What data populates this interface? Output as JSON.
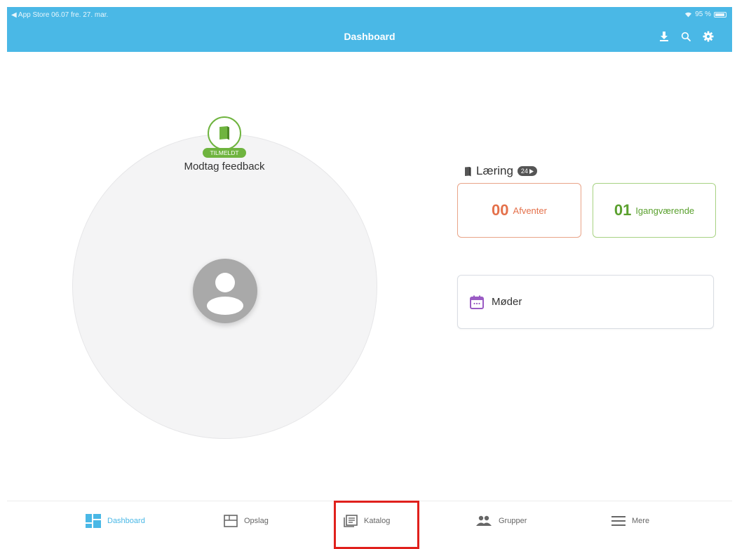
{
  "window": {
    "top_text": "",
    "status_left": "◀ App Store  06.07  fre. 27. mar.",
    "status_right": "95 %",
    "title": "Dashboard"
  },
  "header_icons": [
    "download-icon",
    "search-icon",
    "gear-icon"
  ],
  "course": {
    "badge": "TILMELDT",
    "title": "Modtag feedback"
  },
  "learning": {
    "title": "Læring",
    "count": "24",
    "pending_count": "00",
    "pending_label": "Afventer",
    "inprogress_count": "01",
    "inprogress_label": "Igangværende"
  },
  "meetings": {
    "label": "Møder"
  },
  "tabs": [
    {
      "label": "Dashboard",
      "icon": "dashboard-icon",
      "active": true
    },
    {
      "label": "Opslag",
      "icon": "board-icon",
      "active": false
    },
    {
      "label": "Katalog",
      "icon": "catalog-icon",
      "active": false
    },
    {
      "label": "Grupper",
      "icon": "group-icon",
      "active": false
    },
    {
      "label": "Mere",
      "icon": "menu-icon",
      "active": false
    }
  ],
  "colors": {
    "header": "#4ab8e6",
    "enrolled_green": "#6fb43f",
    "pending_orange": "#e4714b",
    "progress_green": "#5aa02e",
    "highlight_red": "#e0201c"
  }
}
